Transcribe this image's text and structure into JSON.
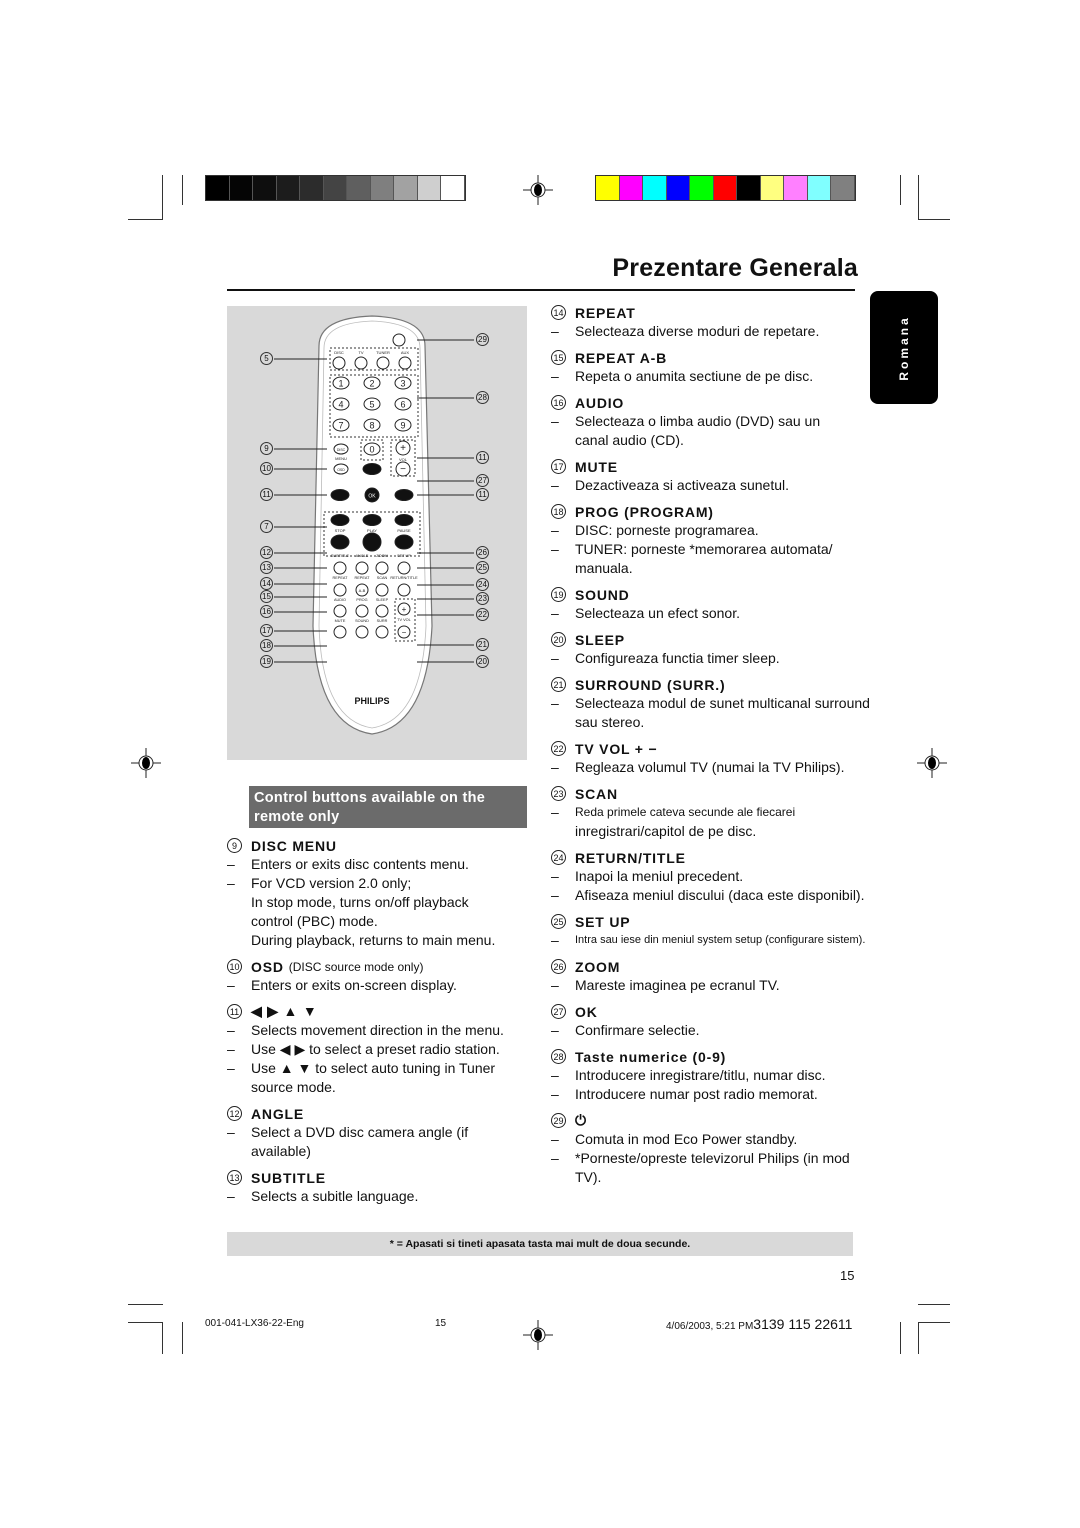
{
  "color_bars": {
    "grayscale": [
      "#000000",
      "#050505",
      "#0e0e0e",
      "#1c1c1c",
      "#2c2c2c",
      "#444444",
      "#5f5f5f",
      "#7f7f7f",
      "#a2a2a2",
      "#cfcfcf",
      "#ffffff"
    ],
    "colors": [
      "#ffff00",
      "#ff00ff",
      "#00ffff",
      "#0000ff",
      "#00ff00",
      "#ff0000",
      "#000000",
      "#ffff80",
      "#ff80ff",
      "#80ffff",
      "#808080"
    ]
  },
  "header": {
    "title": "Prezentare Generala",
    "language_tab": "Romana"
  },
  "remote": {
    "brand": "PHILIPS",
    "source_labels": [
      "DISC",
      "TV",
      "TUNER",
      "AUX"
    ],
    "digits": [
      "1",
      "2",
      "3",
      "4",
      "5",
      "6",
      "7",
      "8",
      "9",
      "0"
    ],
    "disc_menu": [
      "DISC",
      "MENU"
    ],
    "osd": "OSD",
    "vol": "VOL",
    "ok": "OK",
    "transport_labels": [
      "STOP",
      "PLAY",
      "PAUSE"
    ],
    "row_labels_1": [
      "SUBTITLE",
      "ANGLE",
      "ZOOM",
      "SET UP"
    ],
    "row_labels_2": [
      "REPEAT",
      "REPEAT",
      "SCAN",
      "RETURN/TITLE"
    ],
    "ab_label": "A-B",
    "row_labels_3": [
      "AUDIO",
      "PROG",
      "SLEEP"
    ],
    "row_labels_4": [
      "MUTE",
      "SOUND",
      "SURR"
    ],
    "tv_vol": "TV VOL",
    "callouts_left": [
      "5",
      "9",
      "10",
      "11",
      "7",
      "12",
      "13",
      "14",
      "15",
      "16",
      "17",
      "18",
      "19"
    ],
    "callouts_right": [
      "29",
      "28",
      "11",
      "27",
      "11",
      "26",
      "25",
      "24",
      "23",
      "22",
      "21",
      "20"
    ]
  },
  "callout_box": "Control buttons available on the remote only",
  "left_items": [
    {
      "num": "9",
      "title": "DISC MENU",
      "lines": [
        {
          "dash": true,
          "text": "Enters or exits disc contents menu."
        },
        {
          "dash": true,
          "text": "For VCD version 2.0 only;"
        },
        {
          "dash": false,
          "text": "In stop mode, turns on/off playback"
        },
        {
          "dash": false,
          "text": "control (PBC) mode."
        },
        {
          "dash": false,
          "text": "During playback, returns to main menu."
        }
      ]
    },
    {
      "num": "10",
      "title": "OSD",
      "subtitle": "(DISC source mode only)",
      "lines": [
        {
          "dash": true,
          "text": "Enters or exits on-screen display."
        }
      ]
    },
    {
      "num": "11",
      "title": "◀ ▶ ▲ ▼",
      "lines": [
        {
          "dash": true,
          "text": "Selects movement direction in the menu."
        },
        {
          "dash": true,
          "text": "Use ◀ ▶  to select a preset radio station."
        },
        {
          "dash": true,
          "text": "Use ▲ ▼  to select auto tuning in Tuner"
        },
        {
          "dash": false,
          "text": "source mode."
        }
      ]
    },
    {
      "num": "12",
      "title": "ANGLE",
      "lines": [
        {
          "dash": true,
          "text": "Select a DVD disc camera angle (if"
        },
        {
          "dash": false,
          "text": "available)"
        }
      ]
    },
    {
      "num": "13",
      "title": "SUBTITLE",
      "lines": [
        {
          "dash": true,
          "text": "Selects a subitle language."
        }
      ]
    }
  ],
  "right_items": [
    {
      "num": "14",
      "title": "REPEAT",
      "lines": [
        {
          "dash": true,
          "text": "Selecteaza diverse moduri de repetare."
        }
      ]
    },
    {
      "num": "15",
      "title": "REPEAT A-B",
      "lines": [
        {
          "dash": true,
          "text": "Repeta o anumita sectiune de pe disc."
        }
      ]
    },
    {
      "num": "16",
      "title": "AUDIO",
      "lines": [
        {
          "dash": true,
          "text": "Selecteaza o limba audio (DVD) sau un"
        },
        {
          "dash": false,
          "text": "canal audio (CD)."
        }
      ]
    },
    {
      "num": "17",
      "title": "MUTE",
      "lines": [
        {
          "dash": true,
          "text": "Dezactiveaza si activeaza sunetul."
        }
      ]
    },
    {
      "num": "18",
      "title": "PROG (PROGRAM)",
      "lines": [
        {
          "dash": true,
          "text": "DISC: porneste programarea."
        },
        {
          "dash": true,
          "text": "TUNER: porneste *memorarea automata/"
        },
        {
          "dash": false,
          "text": "manuala."
        }
      ]
    },
    {
      "num": "19",
      "title": "SOUND",
      "lines": [
        {
          "dash": true,
          "text": "Selecteaza un efect sonor."
        }
      ]
    },
    {
      "num": "20",
      "title": "SLEEP",
      "lines": [
        {
          "dash": true,
          "text": "Configureaza functia timer sleep."
        }
      ]
    },
    {
      "num": "21",
      "title": "SURROUND (SURR.)",
      "lines": [
        {
          "dash": true,
          "text": "Selecteaza modul de sunet multicanal surround"
        },
        {
          "dash": false,
          "text": "sau stereo."
        }
      ]
    },
    {
      "num": "22",
      "title": "TV VOL  + −",
      "lines": [
        {
          "dash": true,
          "text": "Regleaza volumul TV (numai la TV Philips)."
        }
      ]
    },
    {
      "num": "23",
      "title": "SCAN",
      "lines": [
        {
          "dash": true,
          "text": "Reda primele cateva secunde ale fiecarei",
          "size": "small"
        },
        {
          "dash": false,
          "text": "inregistrari/capitol de pe disc."
        }
      ]
    },
    {
      "num": "24",
      "title": "RETURN/TITLE",
      "lines": [
        {
          "dash": true,
          "text": "Inapoi la meniul precedent."
        },
        {
          "dash": true,
          "text": "Afiseaza meniul discului (daca este disponibil)."
        }
      ]
    },
    {
      "num": "25",
      "title": "SET UP",
      "lines": [
        {
          "dash": true,
          "text": "Intra sau iese din meniul system setup (configurare sistem).",
          "size": "tiny"
        }
      ]
    },
    {
      "num": "26",
      "title": "ZOOM",
      "lines": [
        {
          "dash": true,
          "text": "Mareste imaginea pe ecranul TV."
        }
      ]
    },
    {
      "num": "27",
      "title": "OK",
      "lines": [
        {
          "dash": true,
          "text": "Confirmare selectie."
        }
      ]
    },
    {
      "num": "28",
      "title": "Taste numerice (0-9)",
      "lines": [
        {
          "dash": true,
          "text": "Introducere inregistrare/titlu, numar disc."
        },
        {
          "dash": true,
          "text": "Introducere numar post radio memorat."
        }
      ]
    },
    {
      "num": "29",
      "title": "⏻",
      "lines": [
        {
          "dash": true,
          "text": "Comuta in mod Eco Power standby."
        },
        {
          "dash": true,
          "text": "*Porneste/opreste televizorul Philips (in mod"
        },
        {
          "dash": false,
          "text": "TV)."
        }
      ]
    }
  ],
  "footnote": "* = Apasati si tineti apasata tasta mai mult de doua secunde.",
  "page_number": "15",
  "footer": {
    "file": "001-041-LX36-22-Eng",
    "page": "15",
    "date": "4/06/2003, 5:21 PM",
    "code": "3139 115 22611"
  }
}
